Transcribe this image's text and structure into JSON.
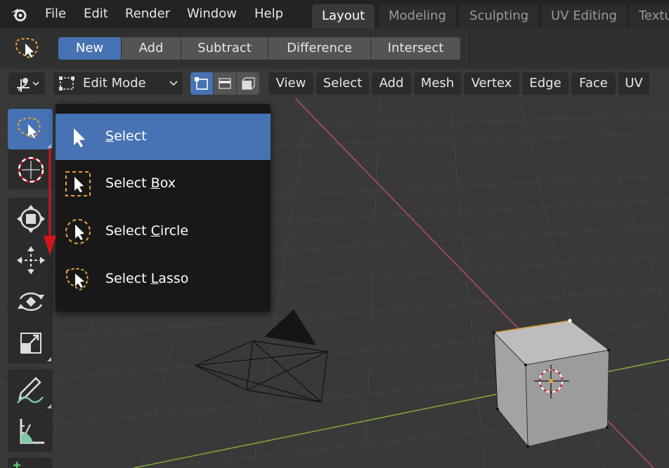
{
  "topbar": {
    "menu": [
      "File",
      "Edit",
      "Render",
      "Window",
      "Help"
    ],
    "workspaces": [
      "Layout",
      "Modeling",
      "Sculpting",
      "UV Editing",
      "Textu"
    ],
    "active_workspace": "Layout"
  },
  "tool_header": {
    "active_tool_icon": "select-lasso-icon",
    "modes": [
      "New",
      "Add",
      "Subtract",
      "Difference",
      "Intersect"
    ],
    "active_mode": "New"
  },
  "viewport_header": {
    "editor_type_icon": "3d-viewport-icon",
    "interaction_mode": "Edit Mode",
    "select_modes": [
      "vertex-select-icon",
      "edge-select-icon",
      "face-select-icon"
    ],
    "active_select_mode": "vertex-select-icon",
    "menus": [
      "View",
      "Select",
      "Add",
      "Mesh",
      "Vertex",
      "Edge",
      "Face",
      "UV"
    ]
  },
  "toolbar": {
    "tools": [
      "select-icon",
      "cursor-icon",
      "transform-icon",
      "move-icon",
      "rotate-icon",
      "scale-icon",
      "annotate-icon",
      "measure-icon",
      "add-cube-icon"
    ],
    "active_tool": "select-icon"
  },
  "popup": {
    "items": [
      {
        "pre": "",
        "key": "S",
        "post": "elect",
        "icon": "select-icon",
        "active": true
      },
      {
        "pre": "Select ",
        "key": "B",
        "post": "ox",
        "icon": "select-box-icon",
        "active": false
      },
      {
        "pre": "Select ",
        "key": "C",
        "post": "ircle",
        "icon": "select-circle-icon",
        "active": false
      },
      {
        "pre": "Select ",
        "key": "L",
        "post": "asso",
        "icon": "select-lasso-icon",
        "active": false
      }
    ]
  },
  "colors": {
    "accent": "#4772b3",
    "grid_bg": "#393939",
    "x_axis": "#b5525a",
    "y_axis": "#7fa93a",
    "annotation_arrow": "#d0161c",
    "select_dash": "#e6a33a"
  }
}
